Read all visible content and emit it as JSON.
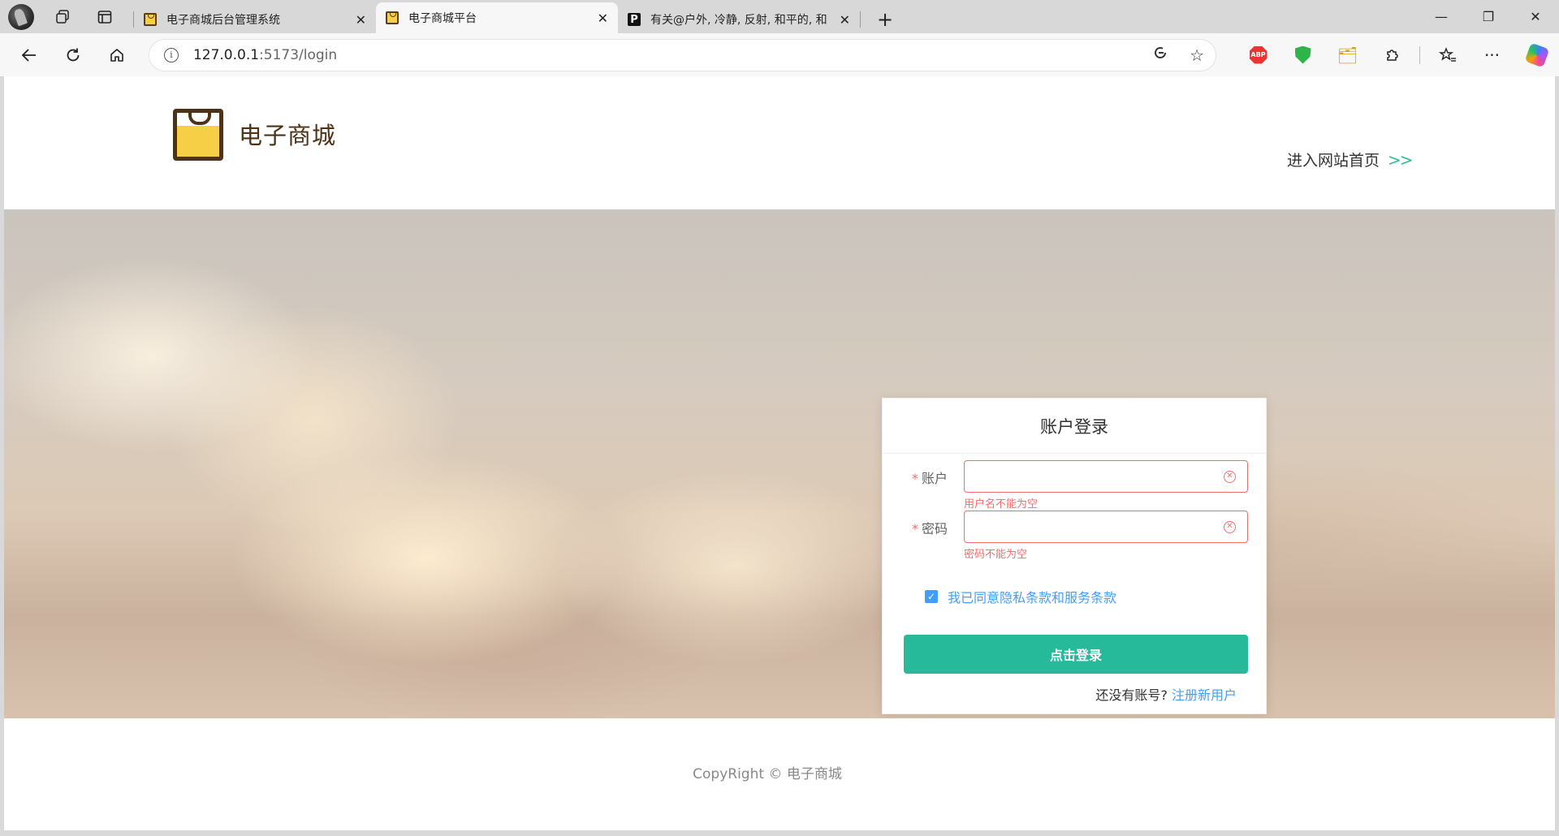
{
  "browser": {
    "tabs": [
      {
        "title": "电子商城后台管理系统",
        "active": false,
        "favicon": "bag-icon"
      },
      {
        "title": "电子商城平台",
        "active": true,
        "favicon": "bag-icon"
      },
      {
        "title": "有关@户外, 冷静, 反射, 和平的, 和",
        "active": false,
        "favicon": "p-icon"
      }
    ],
    "url_host": "127.0.0.1",
    "url_path": ":5173/login",
    "abp_label": "ABP"
  },
  "site": {
    "name": "电子商城",
    "home_link": "进入网站首页",
    "home_arrows": ">>"
  },
  "login": {
    "title": "账户登录",
    "account_label": "账户",
    "account_value": "",
    "account_error": "用户名不能为空",
    "password_label": "密码",
    "password_value": "",
    "password_error": "密码不能为空",
    "required_mark": "*",
    "agree_label": "我已同意隐私条款和服务条款",
    "agree_checked": true,
    "submit_label": "点击登录",
    "no_account_text": "还没有账号?",
    "register_link": "注册新用户"
  },
  "footer": {
    "copyright": "CopyRight © 电子商城"
  },
  "colors": {
    "accent": "#26b99a",
    "error": "#f56c6c",
    "link": "#409eff",
    "brand_dark": "#4d3216",
    "brand_yellow": "#f6cf47"
  }
}
